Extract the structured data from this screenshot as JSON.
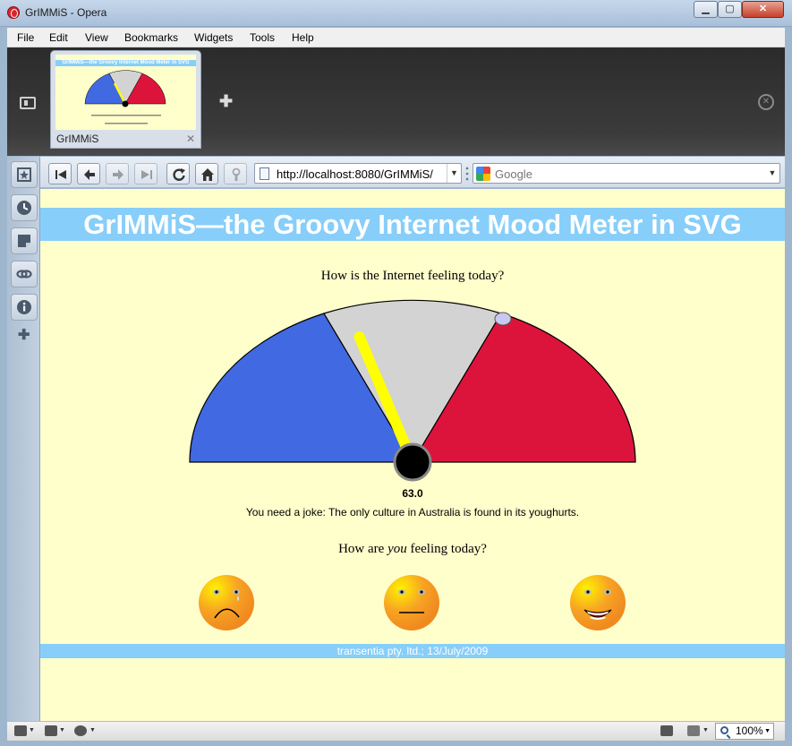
{
  "window": {
    "title": "GrIMMiS - Opera"
  },
  "menu": [
    "File",
    "Edit",
    "View",
    "Bookmarks",
    "Widgets",
    "Tools",
    "Help"
  ],
  "tab": {
    "label": "GrIMMiS",
    "thumb_title": "GrIMMiS—the Groovy Internet Mood Meter in SVG"
  },
  "toolbar": {
    "address": "http://localhost:8080/GrIMMiS/",
    "search_placeholder": "Google"
  },
  "page": {
    "title": "GrIMMiS—the Groovy Internet Mood Meter in SVG",
    "question1": "How is the Internet feeling today?",
    "reading": "63.0",
    "joke": "You need a joke: The only culture in Australia is found in its youghurts.",
    "question2_pre": "How are ",
    "question2_em": "you",
    "question2_post": " feeling today?",
    "footer": "transentia pty. ltd.; 13/July/2009"
  },
  "gauge": {
    "value": 63.0,
    "needle_angle_deg": 113,
    "colors": {
      "sad": "#4169e1",
      "neutral": "#d3d3d3",
      "happy": "#dc143c",
      "needle": "#ffff00",
      "hub": "#000000"
    }
  },
  "faces": [
    {
      "name": "sad-face",
      "mood": "sad"
    },
    {
      "name": "neutral-face",
      "mood": "neutral"
    },
    {
      "name": "happy-face",
      "mood": "happy"
    }
  ],
  "statusbar": {
    "zoom": "100%"
  }
}
